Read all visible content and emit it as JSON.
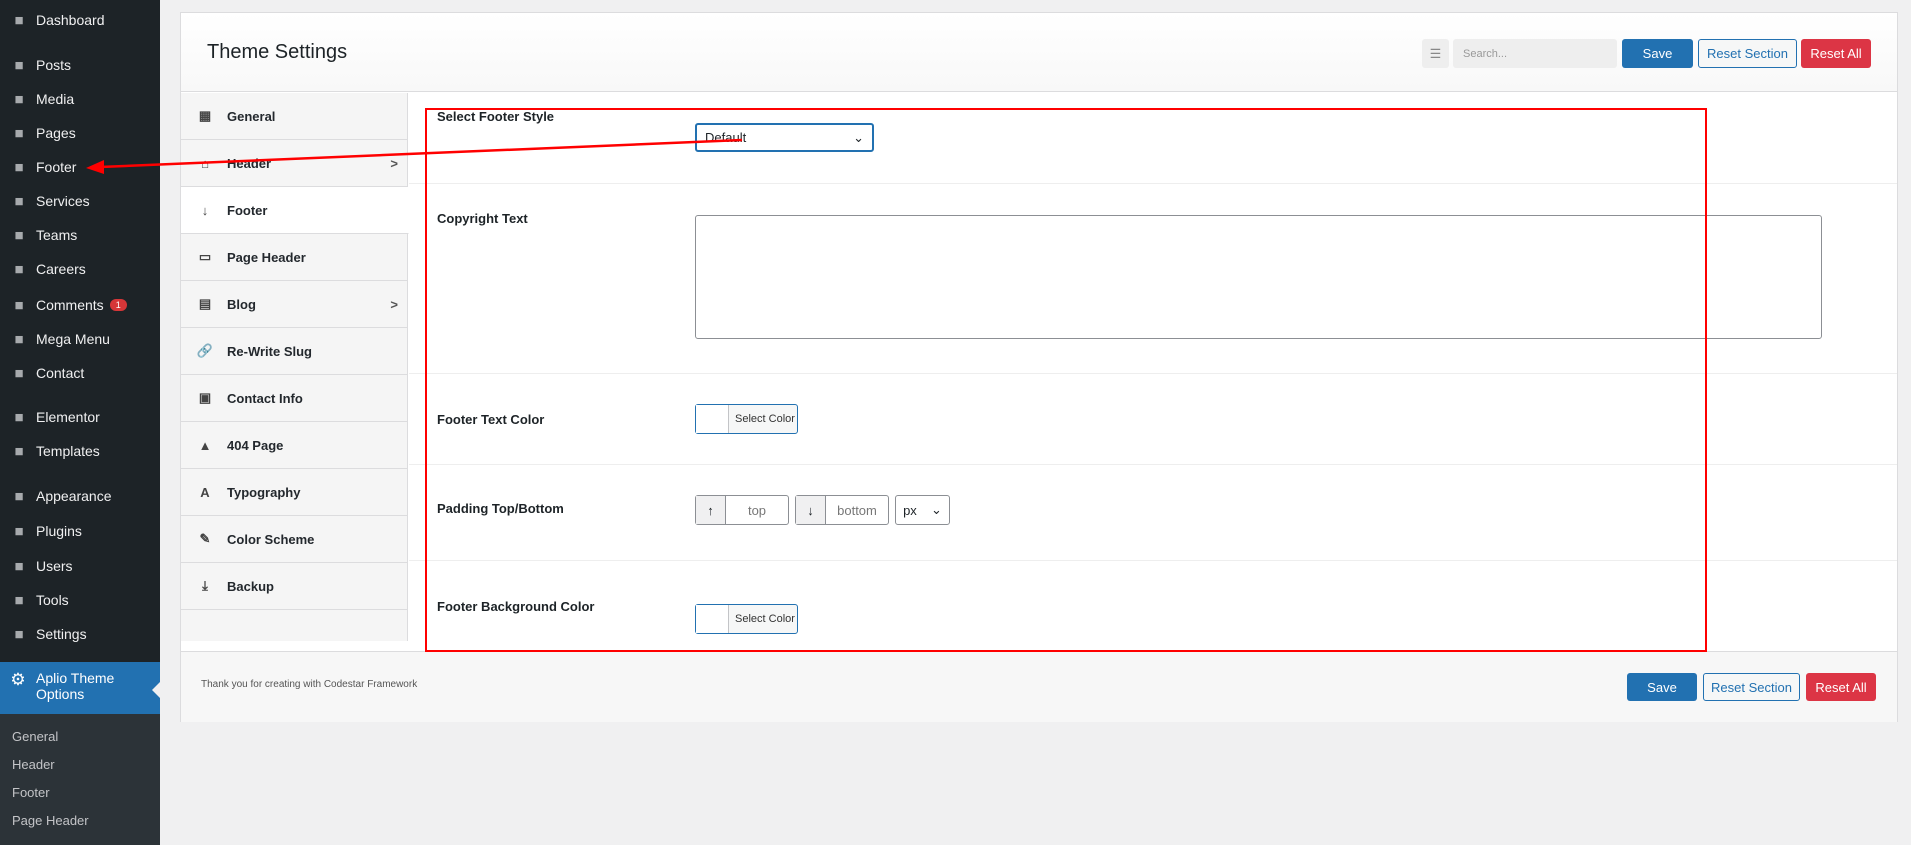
{
  "sidebar": {
    "items": [
      {
        "label": "Dashboard",
        "icon": "dashboard-icon"
      },
      {
        "label": "Posts",
        "icon": "pin-icon"
      },
      {
        "label": "Media",
        "icon": "media-icon"
      },
      {
        "label": "Pages",
        "icon": "pages-icon"
      },
      {
        "label": "Footer",
        "icon": "pin-icon"
      },
      {
        "label": "Services",
        "icon": "list-icon"
      },
      {
        "label": "Teams",
        "icon": "groups-icon"
      },
      {
        "label": "Careers",
        "icon": "lightbulb-icon"
      },
      {
        "label": "Comments",
        "icon": "comment-icon",
        "badge": "1"
      },
      {
        "label": "Mega Menu",
        "icon": "download-icon"
      },
      {
        "label": "Contact",
        "icon": "email-icon"
      },
      {
        "label": "Elementor",
        "icon": "elementor-icon"
      },
      {
        "label": "Templates",
        "icon": "folder-icon"
      },
      {
        "label": "Appearance",
        "icon": "brush-icon"
      },
      {
        "label": "Plugins",
        "icon": "plugin-icon"
      },
      {
        "label": "Users",
        "icon": "user-icon"
      },
      {
        "label": "Tools",
        "icon": "wrench-icon"
      },
      {
        "label": "Settings",
        "icon": "settings-icon"
      }
    ],
    "active": "Aplio Theme Options",
    "sub": [
      "General",
      "Header",
      "Footer",
      "Page Header"
    ]
  },
  "header": {
    "title": "Theme Settings",
    "search_placeholder": "Search...",
    "save": "Save",
    "reset_section": "Reset Section",
    "reset_all": "Reset All"
  },
  "nav": [
    {
      "label": "General",
      "icon": "▦"
    },
    {
      "label": "Header",
      "icon": "⌂",
      "chevron": ">"
    },
    {
      "label": "Footer",
      "icon": "↓"
    },
    {
      "label": "Page Header",
      "icon": "▭"
    },
    {
      "label": "Blog",
      "icon": "▤",
      "chevron": ">"
    },
    {
      "label": "Re-Write Slug",
      "icon": "🔗"
    },
    {
      "label": "Contact Info",
      "icon": "▣"
    },
    {
      "label": "404 Page",
      "icon": "▲"
    },
    {
      "label": "Typography",
      "icon": "A"
    },
    {
      "label": "Color Scheme",
      "icon": "✎"
    },
    {
      "label": "Backup",
      "icon": "⤓"
    }
  ],
  "fields": {
    "footer_style": {
      "label": "Select Footer Style",
      "value": "Default"
    },
    "copyright": {
      "label": "Copyright Text",
      "value": ""
    },
    "text_color": {
      "label": "Footer Text Color",
      "button": "Select Color"
    },
    "padding": {
      "label": "Padding Top/Bottom",
      "top": "top",
      "bottom": "bottom",
      "unit": "px"
    },
    "bg_color": {
      "label": "Footer Background Color",
      "button": "Select Color"
    }
  },
  "footer": {
    "text": "Thank you for creating with Codestar Framework",
    "save": "Save",
    "reset_section": "Reset Section",
    "reset_all": "Reset All"
  },
  "annotation_color": "#ff0000"
}
